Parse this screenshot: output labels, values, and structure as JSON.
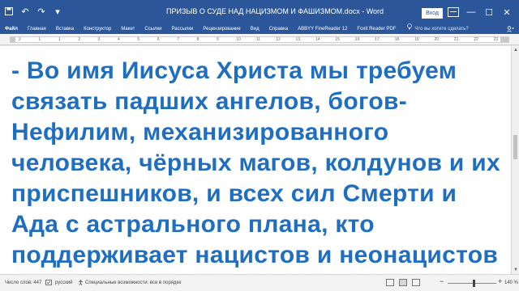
{
  "titlebar": {
    "doc_title": "ПРИЗЫВ О СУДЕ НАД НАЦИЗМОМ И ФАШИЗМОМ.docx - Word",
    "signin_label": "Вход",
    "qat": {
      "save_icon": "save-icon",
      "undo_icon": "undo-icon",
      "redo_icon": "redo-icon",
      "customize_icon": "customize-qat-icon"
    },
    "window_controls": {
      "minimize": "—",
      "maximize": "☐",
      "close": "✕"
    }
  },
  "ribbon": {
    "tabs": [
      {
        "label": "Файл",
        "active": true
      },
      {
        "label": "Главная"
      },
      {
        "label": "Вставка"
      },
      {
        "label": "Конструктор"
      },
      {
        "label": "Макет"
      },
      {
        "label": "Ссылки"
      },
      {
        "label": "Рассылки"
      },
      {
        "label": "Рецензирование"
      },
      {
        "label": "Вид"
      },
      {
        "label": "Справка"
      },
      {
        "label": "ABBYY FineReader 12"
      },
      {
        "label": "Foxit Reader PDF"
      }
    ],
    "tell_me": "Что вы хотите сделать?"
  },
  "ruler": {
    "numbers": [
      "2",
      "1",
      "1",
      "2",
      "3",
      "4",
      "5",
      "6",
      "7",
      "8",
      "9",
      "10",
      "11",
      "12",
      "13",
      "14",
      "15",
      "16",
      "17",
      "18",
      "19",
      "20",
      "21",
      "22",
      "23"
    ]
  },
  "document": {
    "lines": [
      "- Во имя Иисуса Христа мы требуем",
      "связать падших ангелов, богов-",
      "Нефилим, механизированного",
      "человека, чёрных магов, колдунов и их",
      "приспешников, и всех сил Смерти и",
      "Ада с астрального плана, кто",
      "поддерживает нацистов и неонацистов"
    ],
    "text_color": "#1f6ebf"
  },
  "statusbar": {
    "word_count": "Число слов: 447",
    "language": "русский",
    "accessibility": "Специальные возможности: все в порядке",
    "zoom": "140 %"
  },
  "colors": {
    "accent": "#2b579a"
  }
}
